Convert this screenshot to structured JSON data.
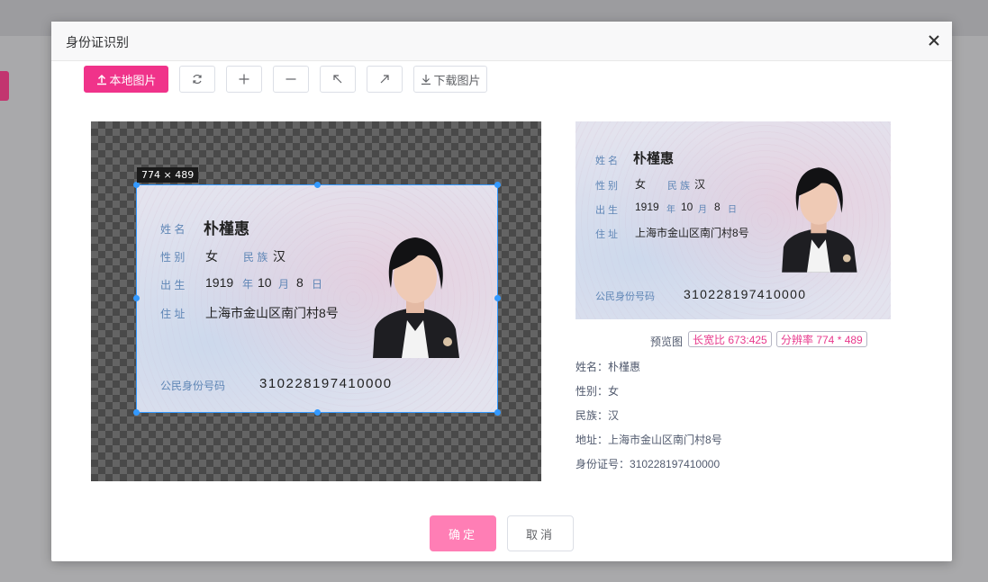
{
  "dialog": {
    "title": "身份证识别"
  },
  "toolbar": {
    "upload_label": "本地图片",
    "download_label": "下载图片",
    "icons": {
      "upload": "upload-icon",
      "refresh": "refresh-icon",
      "zoom_in": "plus-icon",
      "zoom_out": "minus-icon",
      "rotate_left": "arrow-up-left-icon",
      "rotate_right": "arrow-up-right-icon",
      "download": "download-icon"
    }
  },
  "cropper": {
    "size_label": "774 × 489"
  },
  "id_card": {
    "name_label": "姓 名",
    "name": "朴槿惠",
    "gender_label": "性 别",
    "gender": "女",
    "ethnicity_label": "民 族",
    "ethnicity": "汉",
    "birth_label": "出 生",
    "birth_year": "1919",
    "year_char": "年",
    "birth_month": "10",
    "month_char": "月",
    "birth_day": "8",
    "day_char": "日",
    "address_label": "住 址",
    "address": "上海市金山区南门村8号",
    "id_label": "公民身份号码",
    "id_number": "310228197410000"
  },
  "preview": {
    "caption": "预览图",
    "aspect_tag": "长宽比 673:425",
    "resolution_tag": "分辨率 774 * 489"
  },
  "result": [
    {
      "label": "姓名：",
      "value": "朴槿惠"
    },
    {
      "label": "性别：",
      "value": "女"
    },
    {
      "label": "民族：",
      "value": "汉"
    },
    {
      "label": "地址：",
      "value": "上海市金山区南门村8号"
    },
    {
      "label": "身份证号：",
      "value": "310228197410000"
    }
  ],
  "footer": {
    "confirm_label": "确定",
    "cancel_label": "取消"
  },
  "colors": {
    "accent": "#f0338a",
    "confirm": "#ff7eb5",
    "crop_border": "#3399ff",
    "card_label": "#5f86b6"
  }
}
